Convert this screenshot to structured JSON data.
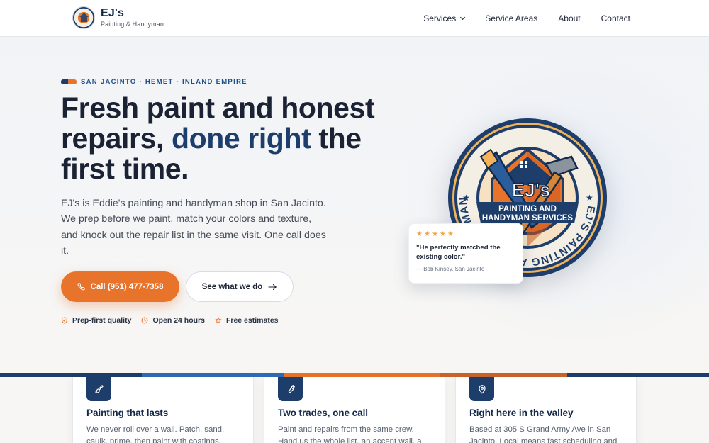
{
  "header": {
    "brand_name": "EJ's",
    "brand_tagline": "Painting & Handyman",
    "nav": [
      {
        "label": "Services",
        "has_dropdown": true
      },
      {
        "label": "Service Areas"
      },
      {
        "label": "About"
      },
      {
        "label": "Contact"
      }
    ]
  },
  "hero": {
    "eyebrow": "SAN JACINTO · HEMET · INLAND EMPIRE",
    "headline_start": "Fresh paint and honest repairs, ",
    "headline_accent": "done right",
    "headline_end": " the first time.",
    "lede": "EJ's is Eddie's painting and handyman shop in San Jacinto. We prep before we paint, match your colors and texture, and knock out the repair list in the same visit. One call does it.",
    "cta_primary": "Call (951) 477-7358",
    "cta_secondary": "See what we do",
    "badges": [
      {
        "icon": "shield-icon",
        "label": "Prep-first quality"
      },
      {
        "icon": "clock-icon",
        "label": "Open 24 hours"
      },
      {
        "icon": "star-outline-icon",
        "label": "Free estimates"
      }
    ],
    "emblem": {
      "initials": "EJ's",
      "banner_line1": "PAINTING AND",
      "banner_line2": "HANDYMAN SERVICES",
      "ring_text": "EJ'S PAINTING AND HANDYMAN SERVICES"
    },
    "review": {
      "rating": 5,
      "quote": "\"He perfectly matched the existing color.\"",
      "author": "— Bob Kinsey, San Jacinto"
    }
  },
  "cards": [
    {
      "icon": "paintbrush-icon",
      "title": "Painting that lasts",
      "body": "We never roll over a wall. Patch, sand, caulk, prime, then paint with coatings."
    },
    {
      "icon": "wrench-icon",
      "title": "Two trades, one call",
      "body": "Paint and repairs from the same crew. Hand us the whole list, an accent wall, a"
    },
    {
      "icon": "map-pin-icon",
      "title": "Right here in the valley",
      "body": "Based at 305 S Grand Army Ave in San Jacinto. Local means fast scheduling and"
    }
  ],
  "colors": {
    "navy": "#1d3d6b",
    "orange": "#e8732a",
    "blue": "#2f6ab8",
    "star": "#f0a33b"
  }
}
